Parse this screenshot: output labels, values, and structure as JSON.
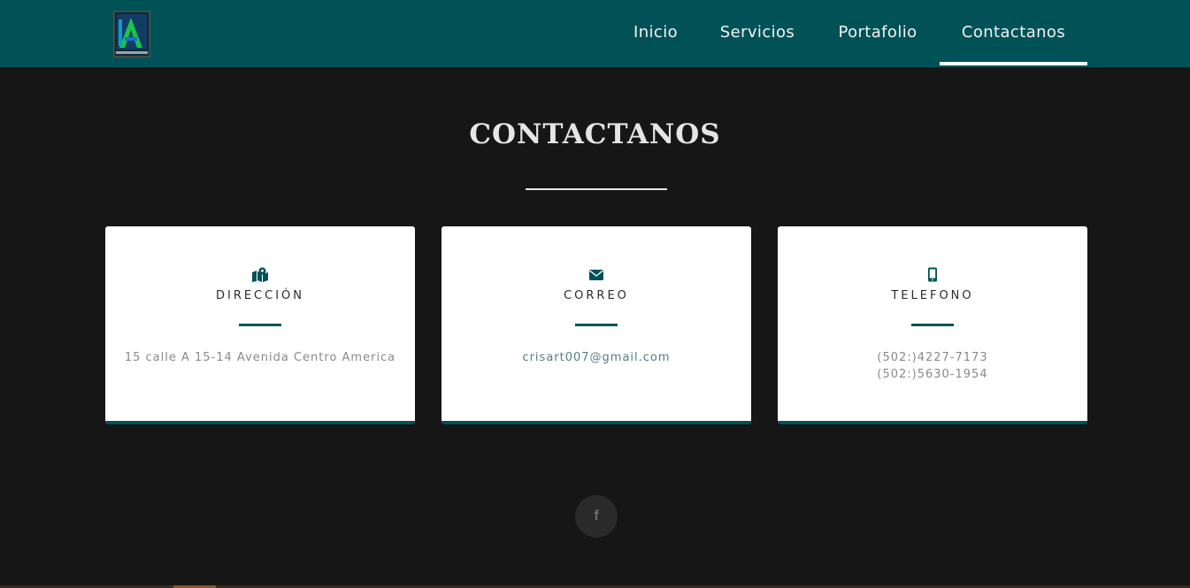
{
  "header": {
    "logo_icon": "brand-logo",
    "nav": [
      {
        "label": "Inicio"
      },
      {
        "label": "Servicios"
      },
      {
        "label": "Portafolio"
      },
      {
        "label": "Contactanos"
      }
    ],
    "active_nav": "Contactanos"
  },
  "main": {
    "title": "CONTACTANOS",
    "cards": [
      {
        "icon": "map-marker-icon",
        "title": "DIRECCIÓN",
        "lines": [
          "15 calle A 15-14 Avenida Centro America"
        ]
      },
      {
        "icon": "envelope-icon",
        "title": "CORREO",
        "lines": [
          "crisart007@gmail.com"
        ]
      },
      {
        "icon": "mobile-phone-icon",
        "title": "TELEFONO",
        "lines": [
          "(502:)4227-7173",
          "(502:)5630-1954"
        ]
      }
    ]
  },
  "footer": {
    "social_icon": "facebook-icon",
    "social_glyph": "f"
  },
  "colors": {
    "brand": "#005257",
    "background": "#161616",
    "card": "#ffffff"
  }
}
